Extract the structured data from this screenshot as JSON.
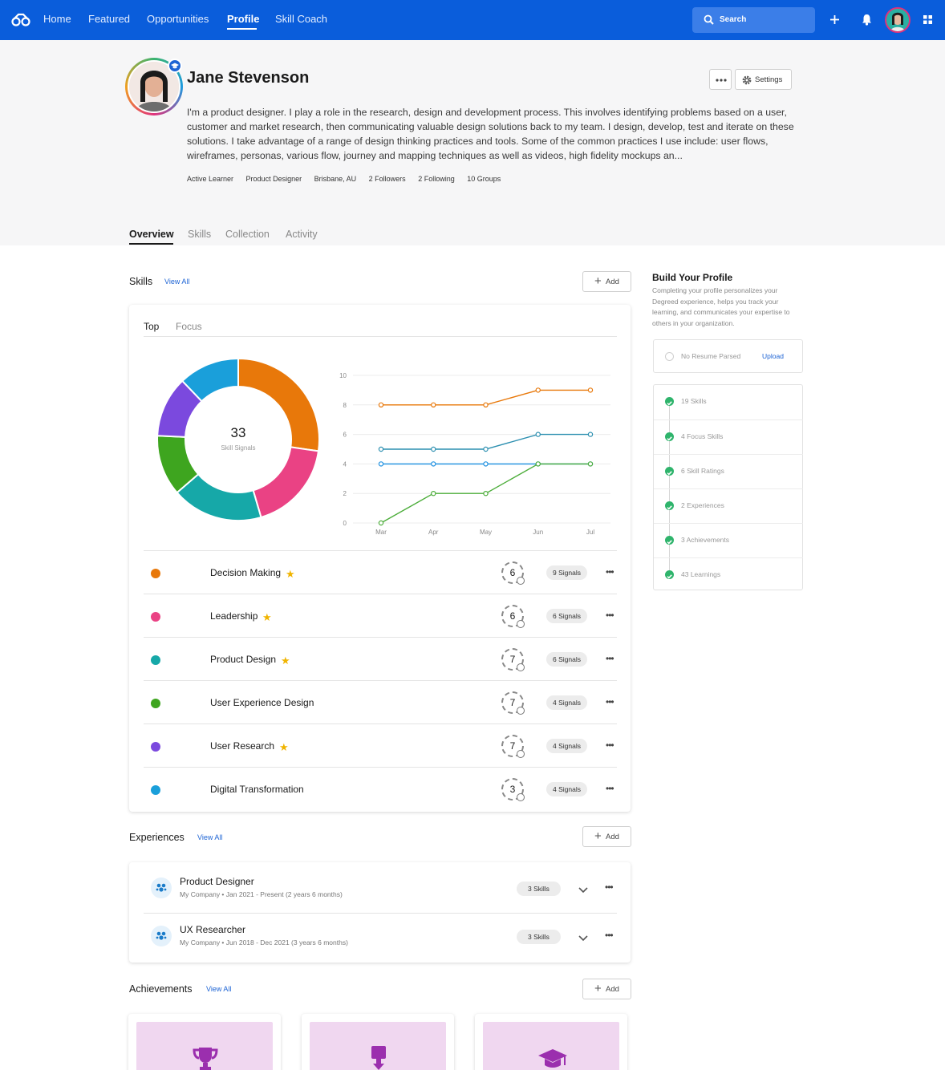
{
  "nav": {
    "items": [
      "Home",
      "Featured",
      "Opportunities",
      "Profile",
      "Skill Coach"
    ],
    "active": "Profile",
    "search_placeholder": "Search"
  },
  "profile": {
    "name": "Jane Stevenson",
    "bio": "I'm a product designer. I play a role in the research, design and development process. This involves identifying problems based on a user, customer and market research, then communicating valuable design solutions back to my team. I design, develop, test and iterate on these solutions. I take advantage of a range of design thinking practices and tools. Some of the common practices I use include: user flows, wireframes, personas, various flow, journey and mapping techniques as well as videos, high fidelity mockups an...",
    "meta": [
      "Active Learner",
      "Product Designer",
      "Brisbane, AU",
      "2 Followers",
      "2 Following",
      "10 Groups"
    ],
    "settings_label": "Settings"
  },
  "tabs": [
    "Overview",
    "Skills",
    "Collection",
    "Activity"
  ],
  "skills_section": {
    "title": "Skills",
    "view_all": "View All",
    "add": "Add",
    "subtabs": [
      "Top",
      "Focus"
    ],
    "total": "33",
    "total_label": "Skill Signals",
    "colors": {
      "orange": "#e8780a",
      "pink": "#ea4284",
      "teal": "#16a8a8",
      "green": "#3ea51f",
      "purple": "#7b49de",
      "blue": "#1a9fda"
    },
    "rows": [
      {
        "name": "Decision Making",
        "star": true,
        "level": "6",
        "signals": "9 Signals",
        "color": "#e8780a"
      },
      {
        "name": "Leadership",
        "star": true,
        "level": "6",
        "signals": "6 Signals",
        "color": "#ea4284"
      },
      {
        "name": "Product Design",
        "star": true,
        "level": "7",
        "signals": "6 Signals",
        "color": "#16a8a8"
      },
      {
        "name": "User Experience Design",
        "star": false,
        "level": "7",
        "signals": "4 Signals",
        "color": "#3ea51f"
      },
      {
        "name": "User Research",
        "star": true,
        "level": "7",
        "signals": "4 Signals",
        "color": "#7b49de"
      },
      {
        "name": "Digital Transformation",
        "star": false,
        "level": "3",
        "signals": "4 Signals",
        "color": "#1a9fda"
      }
    ]
  },
  "chart_data": [
    {
      "type": "pie",
      "categories": [
        "Decision Making",
        "Leadership",
        "Product Design",
        "User Experience Design",
        "User Research",
        "Digital Transformation"
      ],
      "values": [
        9,
        6,
        6,
        4,
        4,
        4
      ],
      "colors": [
        "#e8780a",
        "#ea4284",
        "#16a8a8",
        "#3ea51f",
        "#7b49de",
        "#1a9fda"
      ],
      "title": "",
      "center_value": "33",
      "center_label": "Skill Signals"
    },
    {
      "type": "line",
      "x": [
        "Mar",
        "Apr",
        "May",
        "Jun",
        "Jul"
      ],
      "ylim": [
        0,
        10
      ],
      "yticks": [
        0,
        2,
        4,
        6,
        8,
        10
      ],
      "grid": true,
      "series": [
        {
          "values": [
            8,
            8,
            8,
            9,
            9
          ],
          "color": "#e8780a"
        },
        {
          "values": [
            5,
            5,
            5,
            6,
            6
          ],
          "color": "#2c8fb0"
        },
        {
          "values": [
            4,
            4,
            4,
            4,
            4
          ],
          "color": "#1a8ee0"
        },
        {
          "values": [
            0,
            2,
            2,
            4,
            4
          ],
          "color": "#4cad3a"
        }
      ]
    }
  ],
  "build_profile": {
    "title": "Build Your Profile",
    "desc": "Completing your profile personalizes your Degreed experience, helps you track your learning, and communicates your expertise to others in your organization.",
    "resume": "No Resume Parsed",
    "upload": "Upload",
    "items": [
      "19 Skills",
      "4 Focus Skills",
      "6 Skill Ratings",
      "2 Experiences",
      "3 Achievements",
      "43 Learnings"
    ]
  },
  "experiences": {
    "title": "Experiences",
    "view_all": "View All",
    "add": "Add",
    "items": [
      {
        "title": "Product Designer",
        "sub": "My Company • Jan 2021 - Present (2 years 6 months)",
        "skills": "3 Skills"
      },
      {
        "title": "UX Researcher",
        "sub": "My Company • Jun 2018 - Dec 2021 (3 years 6 months)",
        "skills": "3 Skills"
      }
    ]
  },
  "achievements": {
    "title": "Achievements",
    "view_all": "View All",
    "add": "Add",
    "icons": [
      "trophy-icon",
      "award-icon",
      "graduation-cap-icon"
    ]
  }
}
